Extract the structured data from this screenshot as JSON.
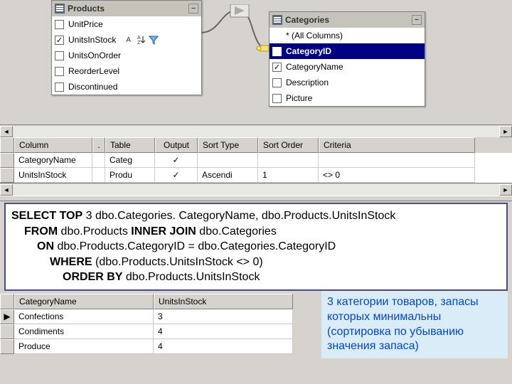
{
  "diagram": {
    "products": {
      "title": "Products",
      "fields": [
        {
          "name": "UnitPrice",
          "checked": false
        },
        {
          "name": "UnitsInStock",
          "checked": true,
          "sort": true,
          "filter": true
        },
        {
          "name": "UnitsOnOrder",
          "checked": false
        },
        {
          "name": "ReorderLevel",
          "checked": false
        },
        {
          "name": "Discontinued",
          "checked": false
        }
      ]
    },
    "categories": {
      "title": "Categories",
      "fields": [
        {
          "name": "* (All Columns)",
          "checked": false,
          "nocheck": true
        },
        {
          "name": "CategoryID",
          "checked": false,
          "selected": true
        },
        {
          "name": "CategoryName",
          "checked": true
        },
        {
          "name": "Description",
          "checked": false
        },
        {
          "name": "Picture",
          "checked": false
        }
      ]
    },
    "sort_label": "A↕Z"
  },
  "design_grid": {
    "headers": {
      "column": "Column",
      "dots": ".",
      "table": "Table",
      "output": "Output",
      "sort_type": "Sort Type",
      "sort_order": "Sort Order",
      "criteria": "Criteria"
    },
    "rows": [
      {
        "column": "CategoryName",
        "table": "Categ",
        "output": "✓",
        "sort_type": "",
        "sort_order": "",
        "criteria": ""
      },
      {
        "column": "UnitsInStock",
        "table": "Produ",
        "output": "✓",
        "sort_type": "Ascendi",
        "sort_order": "1",
        "criteria": "<> 0"
      }
    ]
  },
  "sql": {
    "l1a": "SELECT TOP",
    "l1b": " 3 dbo.Categories. CategoryName, dbo.Products.UnitsInStock",
    "l2a": "FROM",
    "l2b": " dbo.Products ",
    "l2c": "INNER JOIN",
    "l2d": " dbo.Categories",
    "l3a": "ON",
    "l3b": " dbo.Products.CategoryID = dbo.Categories.CategoryID",
    "l4a": "WHERE",
    "l4b": " (dbo.Products.UnitsInStock <> 0)",
    "l5a": "ORDER BY",
    "l5b": " dbo.Products.UnitsInStock"
  },
  "results": {
    "headers": {
      "category": "CategoryName",
      "stock": "UnitsInStock"
    },
    "rows": [
      {
        "category": "Confections",
        "stock": "3"
      },
      {
        "category": "Condiments",
        "stock": "4"
      },
      {
        "category": "Produce",
        "stock": "4"
      }
    ]
  },
  "note": "3 категории товаров,  запасы которых минимальны (сортировка по убыванию значения запаса)"
}
